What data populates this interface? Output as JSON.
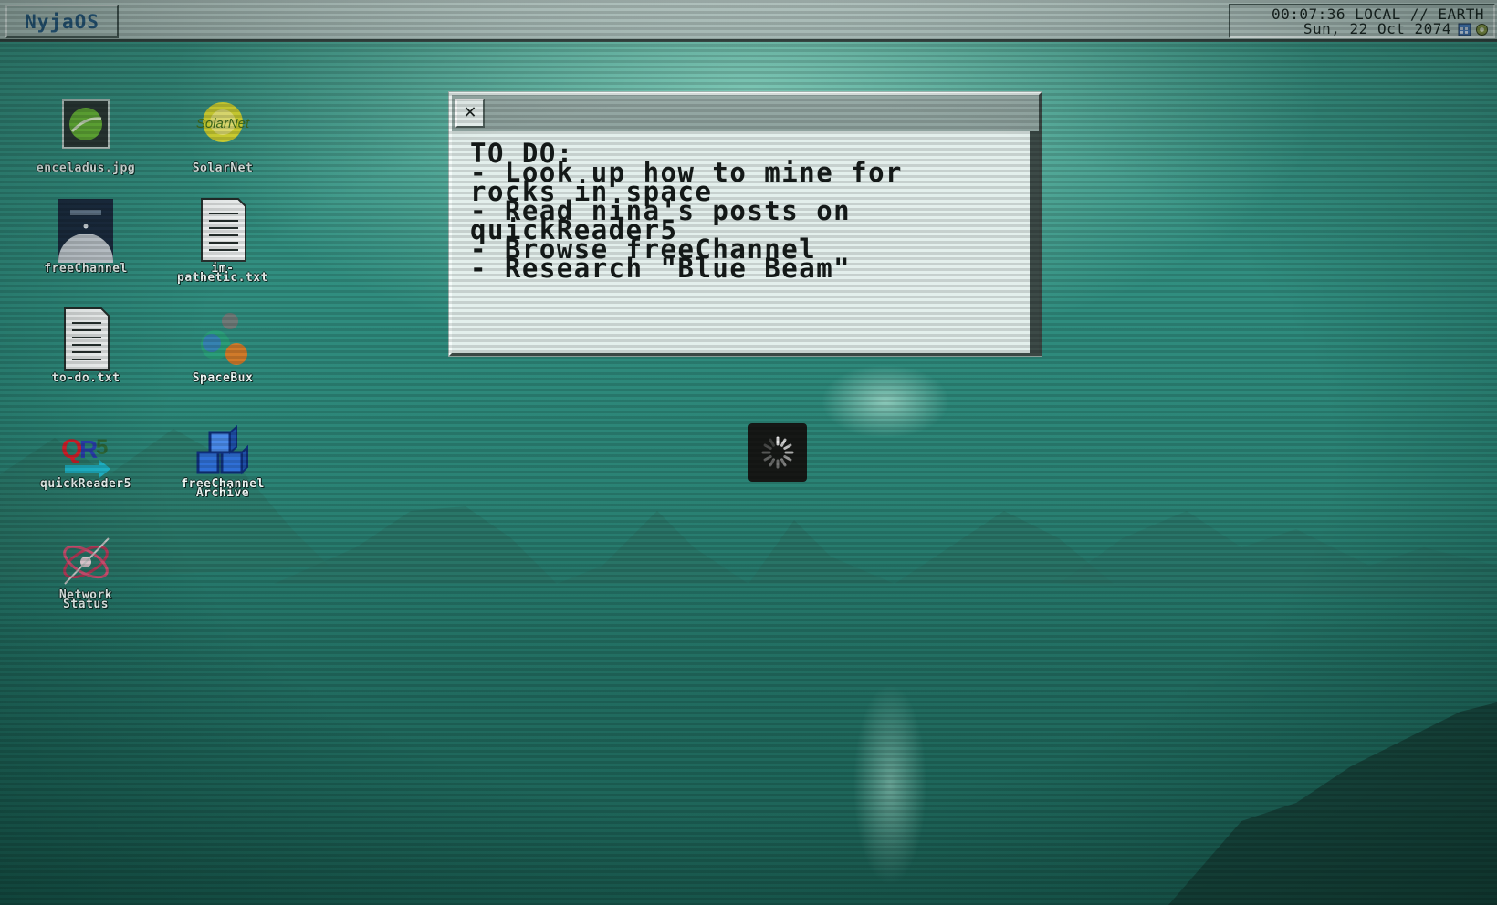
{
  "topbar": {
    "os_label": "NyjaOS",
    "clock_time": "00:07:36 LOCAL // EARTH",
    "clock_date": "Sun, 22 Oct 2074"
  },
  "desktop_icons": [
    {
      "label": "enceladus.jpg",
      "icon": "image-thumbnail-icon"
    },
    {
      "label": "SolarNet",
      "icon": "solarnet-logo-icon"
    },
    {
      "label": "freeChannel",
      "icon": "freechannel-app-icon"
    },
    {
      "label": "im-\npathetic.txt",
      "icon": "text-file-icon"
    },
    {
      "label": "to-do.txt",
      "icon": "text-file-icon"
    },
    {
      "label": "SpaceBux",
      "icon": "spacebux-planets-icon"
    },
    {
      "label": "quickReader5",
      "icon": "quickreader5-icon"
    },
    {
      "label": "freeChannel\nArchive",
      "icon": "archive-cubes-icon"
    },
    {
      "label": "Network\nStatus",
      "icon": "network-satellite-icon"
    }
  ],
  "todo_window": {
    "close_label": "✕",
    "lines": [
      "TO DO:",
      "- Look up how to mine for",
      "rocks in space",
      "- Read nina's posts on",
      "quickReader5",
      "- Browse freeChannel",
      "- Research \"Blue Beam\""
    ]
  },
  "colors": {
    "accent": "#2c5f8a",
    "wallpaper": "#2f8c7e",
    "window_bg": "#e3efec"
  }
}
